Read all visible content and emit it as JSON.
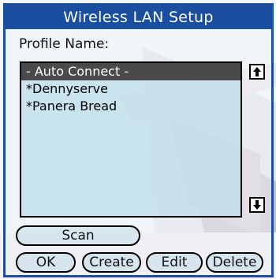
{
  "dialog": {
    "title": "Wireless LAN Setup",
    "profile_label": "Profile Name:"
  },
  "profiles": {
    "items": [
      "- Auto Connect -",
      "*Dennyserve",
      "*Panera Bread"
    ],
    "selected_index": 0
  },
  "buttons": {
    "scan": "Scan",
    "ok": "OK",
    "create": "Create",
    "edit": "Edit",
    "delete": "Delete"
  },
  "icons": {
    "scroll_up": "arrow-up-icon",
    "scroll_down": "arrow-down-icon"
  },
  "colors": {
    "title_bar": "#1a4ea0",
    "selection": "#4a4a4a",
    "list_background": "#bedeea"
  }
}
